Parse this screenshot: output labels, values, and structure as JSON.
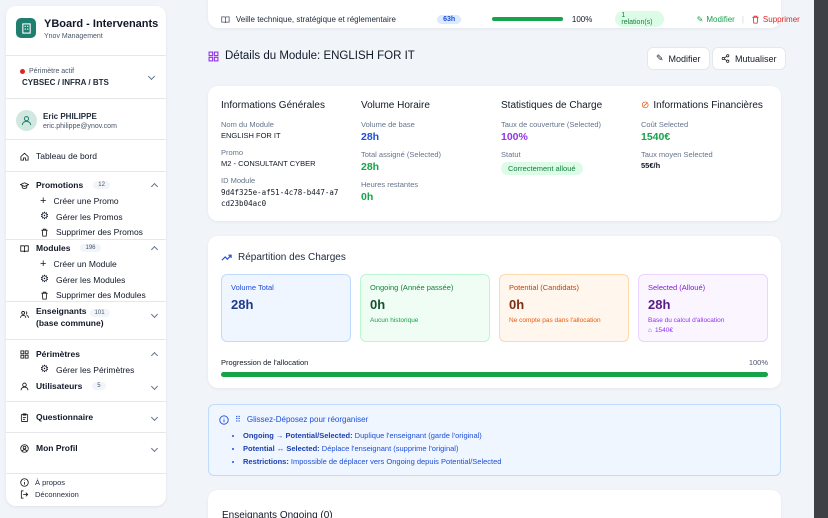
{
  "app": {
    "title": "YBoard - Intervenants",
    "subtitle": "Ynov Management"
  },
  "perimeter": {
    "label": "Périmètre actif",
    "value": "CYBSEC / INFRA / BTS"
  },
  "user": {
    "name": "Eric PHILIPPE",
    "email": "eric.philippe@ynov.com"
  },
  "nav": {
    "dashboard": "Tableau de bord",
    "promotions": {
      "label": "Promotions",
      "count": "12",
      "items": [
        "Créer une Promo",
        "Gérer les Promos",
        "Supprimer des Promos"
      ]
    },
    "modules": {
      "label": "Modules",
      "count": "196",
      "items": [
        "Créer un Module",
        "Gérer les Modules",
        "Supprimer des Modules"
      ]
    },
    "enseignants": {
      "label": "Enseignants",
      "label2": "(base commune)",
      "count": "101"
    },
    "perimetres": {
      "label": "Périmètres",
      "items": [
        "Gérer les Périmètres"
      ]
    },
    "utilisateurs": {
      "label": "Utilisateurs",
      "count": "5"
    },
    "questionnaire": "Questionnaire",
    "profil": "Mon Profil",
    "about": "À propos",
    "logout": "Déconnexion"
  },
  "top_row": {
    "name": "Veille technique, stratégique et réglementaire",
    "hours": "63h",
    "progress_pct": 100,
    "progress_label": "100%",
    "relations": "1 relation(s)",
    "edit": "Modifier",
    "delete": "Supprimer"
  },
  "page": {
    "title": "Détails du Module: ENGLISH FOR IT",
    "edit": "Modifier",
    "share": "Mutualiser"
  },
  "general": {
    "title": "Informations Générales",
    "name_label": "Nom du Module",
    "name": "ENGLISH FOR IT",
    "promo_label": "Promo",
    "promo": "M2 - CONSULTANT CYBER",
    "id_label": "ID Module",
    "id": "9d4f325e-af51-4c78-b447-a7cd23b04ac0"
  },
  "volume": {
    "title": "Volume Horaire",
    "base_label": "Volume de base",
    "base": "28h",
    "assigned_label": "Total assigné (Selected)",
    "assigned": "28h",
    "remaining_label": "Heures restantes",
    "remaining": "0h"
  },
  "stats": {
    "title": "Statistiques de Charge",
    "coverage_label": "Taux de couverture (Selected)",
    "coverage": "100%",
    "status_label": "Statut",
    "status": "Correctement alloué"
  },
  "finance": {
    "title": "Informations Financières",
    "cost_label": "Coût Selected",
    "cost": "1540€",
    "rate_label": "Taux moyen Selected",
    "rate": "55€/h"
  },
  "charges": {
    "title": "Répartition des Charges",
    "boxes": [
      {
        "label": "Volume Total",
        "value": "28h",
        "note": ""
      },
      {
        "label": "Ongoing (Année passée)",
        "value": "0h",
        "note": "Aucun historique"
      },
      {
        "label": "Potential (Candidats)",
        "value": "0h",
        "note": "Ne compte pas dans l'allocation"
      },
      {
        "label": "Selected (Alloué)",
        "value": "28h",
        "note": "Base du calcul d'allocation",
        "cost": "1540€"
      }
    ],
    "progress_label": "Progression de l'allocation",
    "progress_pct": 100,
    "progress_text": "100%"
  },
  "info": {
    "title": "Glissez-Déposez pour réorganiser",
    "rules": [
      {
        "key": "Ongoing → Potential/Selected:",
        "text": " Duplique l'enseignant (garde l'original)"
      },
      {
        "key": "Potential ↔ Selected:",
        "text": " Déplace l'enseignant (supprime l'original)"
      },
      {
        "key": "Restrictions:",
        "text": " Impossible de déplacer vers Ongoing depuis Potential/Selected"
      }
    ]
  },
  "bottom": {
    "title": "Enseignants Ongoing (0)"
  },
  "colors": {
    "brand": "#1e7f6e",
    "green": "#16a34a",
    "blue": "#1d4ed8",
    "purple": "#9333ea",
    "red": "#dc2626"
  }
}
